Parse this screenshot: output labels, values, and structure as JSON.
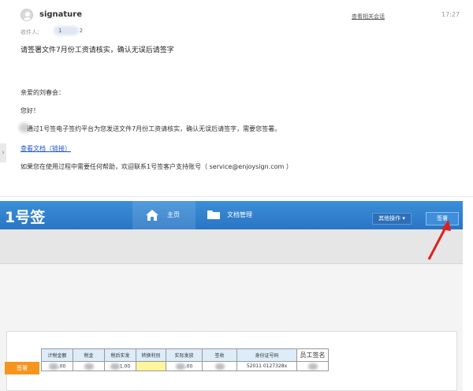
{
  "email": {
    "sender": "signature",
    "related_link": "查看相关会话",
    "time": "17:27",
    "recipient_label": "收件人：",
    "recipient_value": "1 2",
    "subject": "请签署文件7月份工资请核实，确认无误后请签字",
    "greeting": "亲爱的刘春会：",
    "hello": "您好！",
    "body_line": "通过1号签电子签约平台为您发送文件7月份工资请核实，确认无误后请签字，需要您签署。",
    "view_link": "查看文档（链接）",
    "help_line": "如果您在使用过程中需要任何帮助，欢迎联系1号签客户支持账号（ service@enjoysign.com ）"
  },
  "app": {
    "logo": "1号签",
    "nav_home": "主页",
    "nav_docs": "文档管理",
    "more_ops": "其他操作 ▾",
    "sign_button": "签署",
    "sign_tag": "签署"
  },
  "table": {
    "headers": [
      "计税金额",
      "税金",
      "税后实发",
      "转换利别",
      "实际发放",
      "签收",
      "身份证号码"
    ],
    "signature_header": "员工签名",
    "row": [
      ".00",
      "",
      "1.00",
      "",
      ".00",
      "",
      "52011        0127328x"
    ]
  },
  "colors": {
    "header_blue": "#2f7fcf",
    "sign_orange": "#f7941d",
    "arrow_red": "#e02020"
  }
}
